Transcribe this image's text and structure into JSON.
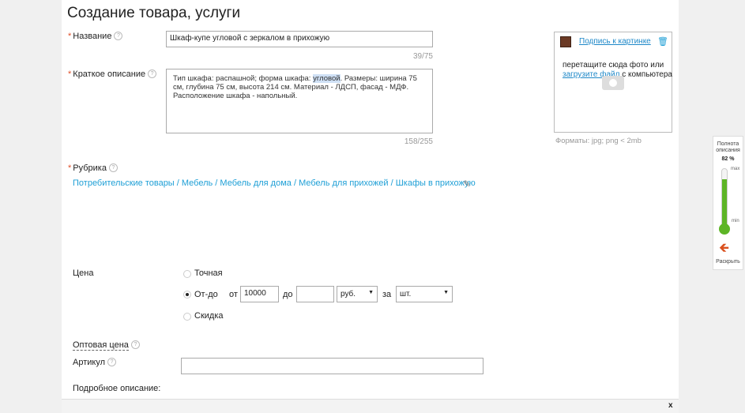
{
  "header": {
    "title": "Создание товара, услуги"
  },
  "name_field": {
    "label": "Название",
    "value": "Шкаф-купе угловой с зеркалом в прихожую",
    "counter": "39/75"
  },
  "short_desc": {
    "label": "Краткое описание",
    "text_before": "Тип шкафа: распашной; форма шкафа: ",
    "text_highlight": "угловой",
    "text_after": ". Размеры: ширина 75 см, глубина 75 см, высота 214 см. Материал - ЛДСП, фасад - МДФ. Расположение шкафа - напольный.",
    "counter": "158/255"
  },
  "photo": {
    "caption_link": "Подпись к картинке",
    "drop_text": "перетащите сюда фото или",
    "upload_link": "загрузите файл",
    "from_computer": "с компьютера",
    "formats": "Форматы: jpg; png < 2mb"
  },
  "rubric": {
    "label": "Рубрика",
    "path": "Потребительские товары / Мебель / Мебель для дома / Мебель для прихожей / Шкафы в прихожую"
  },
  "price": {
    "label": "Цена",
    "options": [
      "Точная",
      "От-до",
      "Скидка"
    ],
    "selected": "От-до",
    "from_label": "от",
    "from_value": "10000",
    "to_label": "до",
    "to_value": "",
    "currency": "руб.",
    "per_label": "за",
    "unit": "шт."
  },
  "wholesale": {
    "label": "Оптовая цена"
  },
  "article": {
    "label": "Артикул",
    "value": ""
  },
  "detailed": {
    "label": "Подробное описание:"
  },
  "sidebar": {
    "title": "Полнота описания",
    "percent": "82 %",
    "max": "max",
    "min": "min",
    "collapse": "Раскрыть",
    "fill_level": 0.82
  },
  "close_label": "x",
  "colors": {
    "accent": "#1e9fd6",
    "required": "#e0502a",
    "gauge": "#5db526",
    "arrow": "#d9501e"
  }
}
